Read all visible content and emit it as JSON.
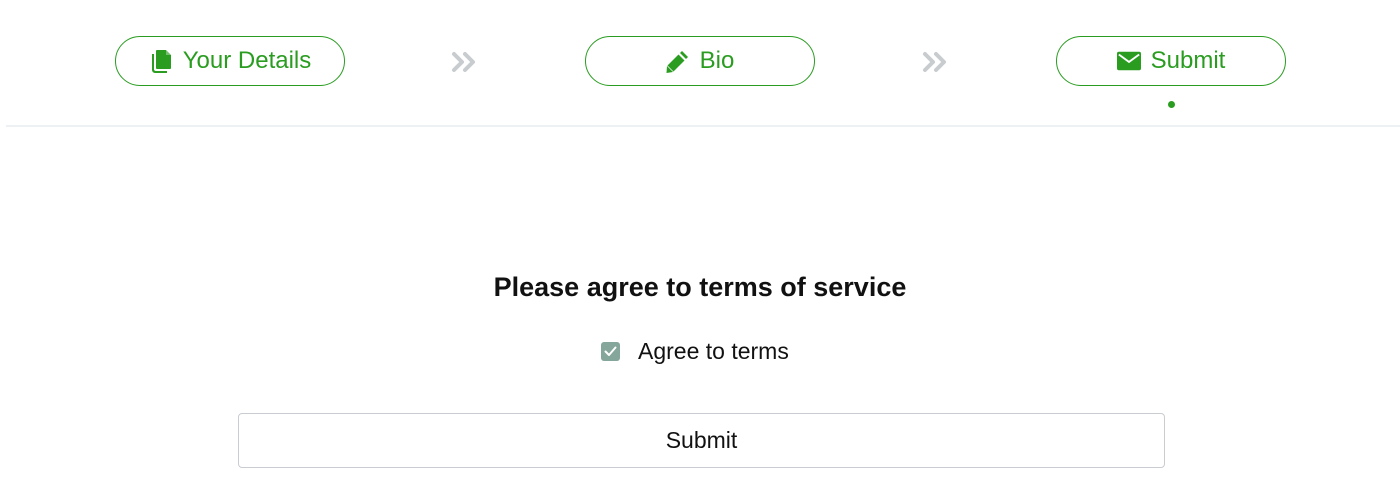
{
  "wizard": {
    "steps": [
      {
        "label": "Your Details",
        "icon": "copy-icon"
      },
      {
        "label": "Bio",
        "icon": "pencil-icon"
      },
      {
        "label": "Submit",
        "icon": "envelope-icon"
      }
    ],
    "separator_icon": "double-chevron-right-icon",
    "active_step": 3
  },
  "form": {
    "title": "Please agree to terms of service",
    "agree_label": "Agree to terms",
    "agree_checked": true,
    "submit_label": "Submit"
  },
  "colors": {
    "accent": "#2a9d21",
    "separator": "#c8cccf",
    "checkbox": "#85a69a",
    "divider": "#eef1f3",
    "button_border": "#c9ccd0"
  }
}
